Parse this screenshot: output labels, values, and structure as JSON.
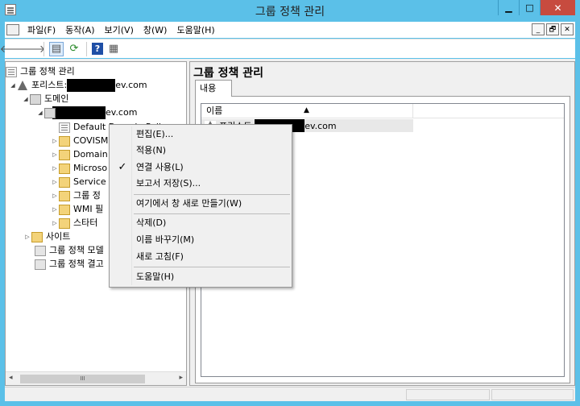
{
  "window": {
    "title": "그룹 정책 관리"
  },
  "caption_buttons": {
    "minimize": "▁",
    "maximize": "□",
    "close": "✕"
  },
  "menubar": {
    "items": [
      {
        "label": "파일(F)"
      },
      {
        "label": "동작(A)"
      },
      {
        "label": "보기(V)"
      },
      {
        "label": "창(W)"
      },
      {
        "label": "도움말(H)"
      }
    ],
    "mdi": {
      "minimize": "_",
      "restore": "🗗",
      "close": "✕"
    }
  },
  "toolbar": {
    "back": "🡐",
    "forward": "🡒",
    "show_hide": "▤",
    "refresh": "⟳",
    "help": "?",
    "props": "▦"
  },
  "tree": {
    "root": "그룹 정책 관리",
    "forest_prefix": "포리스트: ",
    "forest_suffix": "ev.com",
    "domains": "도메인",
    "domain_suffix": "ev.com",
    "items": [
      "Default Domain Poli",
      "COVISM",
      "Domain",
      "Microso",
      "Service",
      "그룹 정",
      "WMI 필",
      "스타터"
    ],
    "sites": "사이트",
    "modeling": "그룹 정책 모델",
    "results": "그룹 정책 결고"
  },
  "right_pane": {
    "title": "그룹 정책 관리",
    "tab": "내용",
    "column_name": "이름",
    "row_prefix": "포리스트: ",
    "row_suffix": "ev.com"
  },
  "context_menu": {
    "items": [
      {
        "label": "편집(E)...",
        "checked": false
      },
      {
        "label": "적용(N)",
        "checked": false
      },
      {
        "label": "연결 사용(L)",
        "checked": true
      },
      {
        "label": "보고서 저장(S)...",
        "checked": false
      },
      {
        "label": "여기에서 창 새로 만들기(W)",
        "checked": false
      },
      {
        "label": "삭제(D)",
        "checked": false
      },
      {
        "label": "이름 바꾸기(M)",
        "checked": false
      },
      {
        "label": "새로 고침(F)",
        "checked": false
      },
      {
        "label": "도움말(H)",
        "checked": false
      }
    ],
    "check_glyph": "✓"
  },
  "scrollbar": {
    "thumb_grip": "III",
    "left": "◂",
    "right": "▸"
  }
}
